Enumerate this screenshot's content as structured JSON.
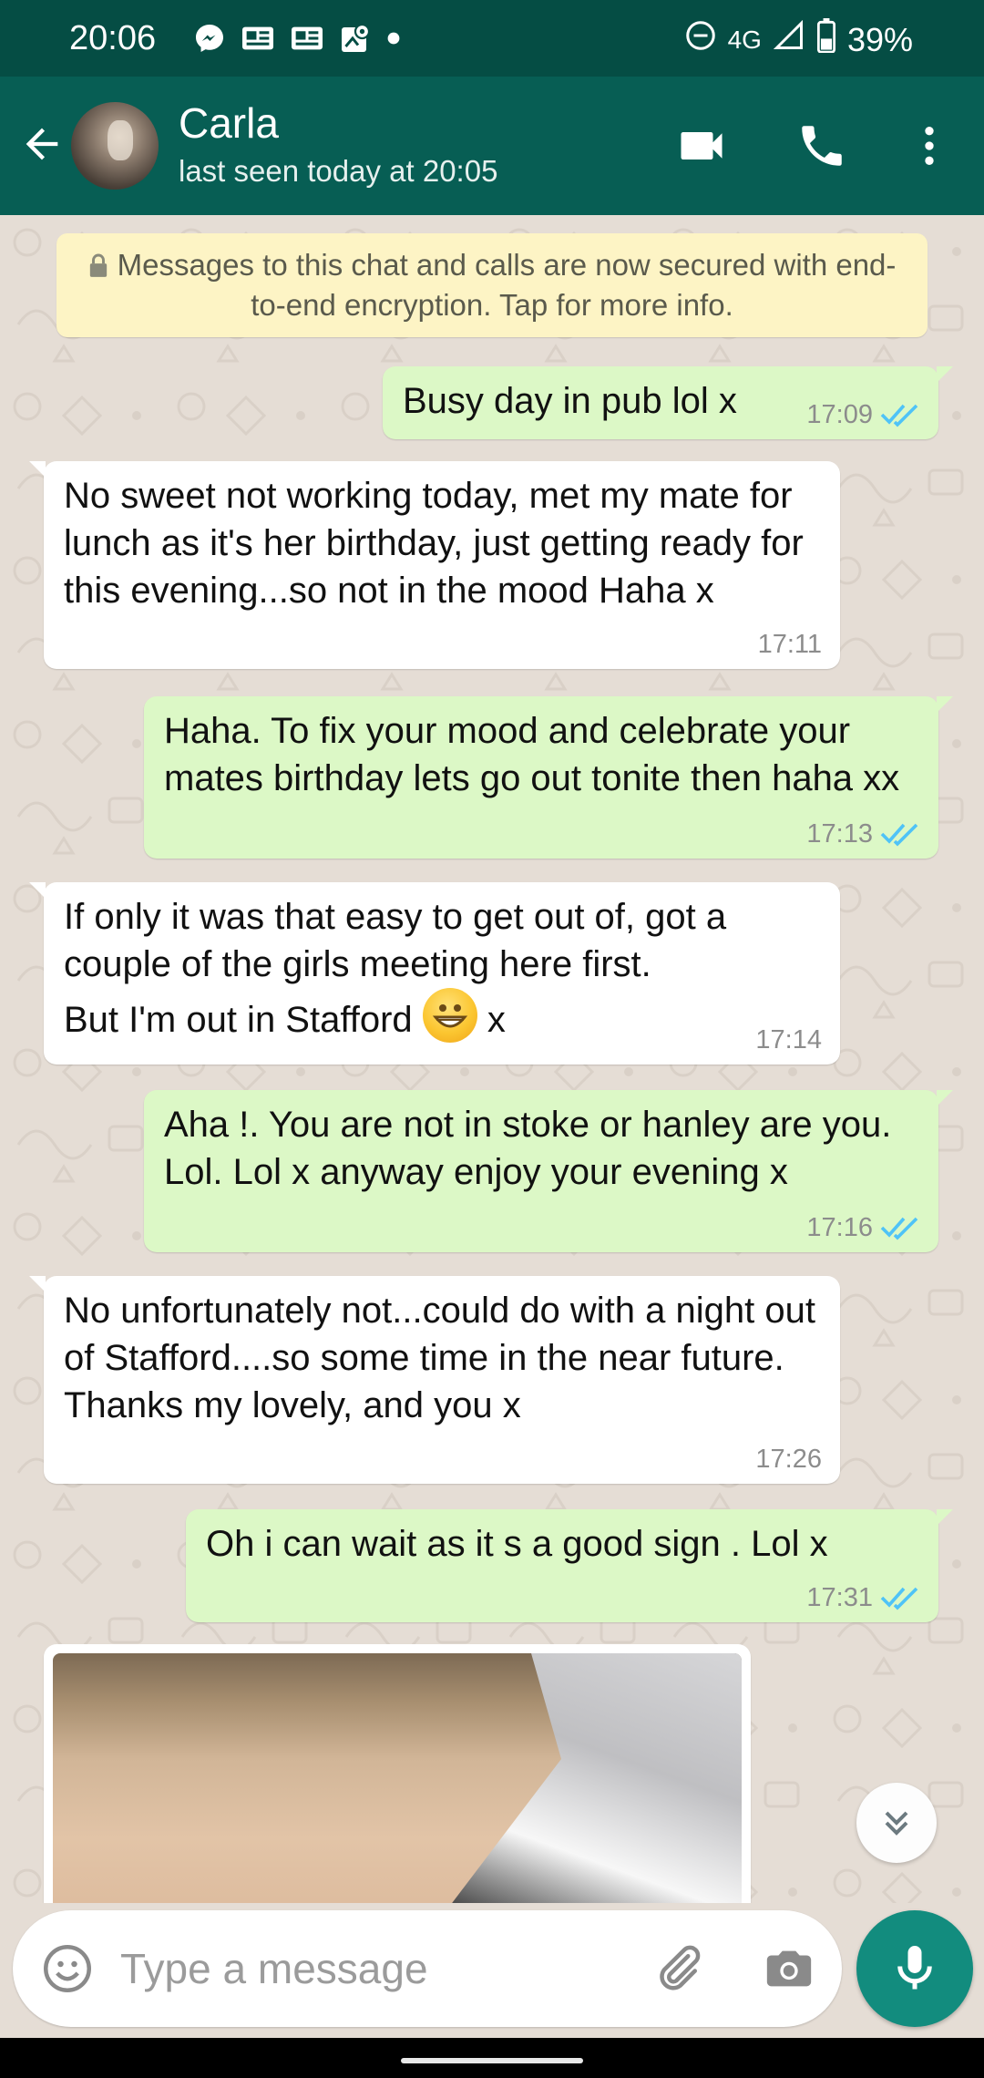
{
  "status_bar": {
    "time": "20:06",
    "network": "4G",
    "battery": "39%",
    "icons": [
      "messenger-icon",
      "news-icon",
      "news-icon",
      "maps-icon",
      "dot-icon",
      "dnd-icon",
      "signal-icon",
      "battery-icon"
    ]
  },
  "header": {
    "name": "Carla",
    "status": "last seen today at 20:05",
    "actions": [
      "video-call-icon",
      "voice-call-icon",
      "more-icon"
    ]
  },
  "encryption_notice": "Messages to this chat and calls are now secured with end-to-end encryption. Tap for more info.",
  "messages": [
    {
      "direction": "out",
      "text": "Busy day in pub  lol x",
      "time": "17:09",
      "read": true
    },
    {
      "direction": "in",
      "text": "No sweet not working today, met my mate for lunch as it's her birthday, just getting ready for this evening...so not in the mood Haha x",
      "time": "17:11"
    },
    {
      "direction": "out",
      "text": "Haha. To fix your mood and celebrate your mates birthday  lets go out tonite then haha xx",
      "time": "17:13",
      "read": true
    },
    {
      "direction": "in",
      "text_line1": "If only it was that easy to get out of, got a couple of the girls meeting here first.",
      "text_line2_before": "But I'm out in Stafford ",
      "emoji": "grinning-face",
      "text_line2_after": " x",
      "time": "17:14"
    },
    {
      "direction": "out",
      "text": "Aha !. You are not in stoke or hanley are you. Lol. Lol x anyway enjoy your evening x",
      "time": "17:16",
      "read": true
    },
    {
      "direction": "in",
      "text": "No unfortunately not...could do with a night out of Stafford....so some time in the near future.\nThanks my lovely, and you x",
      "time": "17:26"
    },
    {
      "direction": "out",
      "text": "Oh  i can wait as it s a good  sign . Lol  x",
      "time": "17:31",
      "read": true
    }
  ],
  "input": {
    "placeholder": "Type a message",
    "value": ""
  },
  "colors": {
    "header": "#075e54",
    "status_bar": "#054d44",
    "outgoing_bubble": "#dcf8c6",
    "incoming_bubble": "#ffffff",
    "read_ticks": "#4fc3f7",
    "fab": "#128c7e"
  }
}
